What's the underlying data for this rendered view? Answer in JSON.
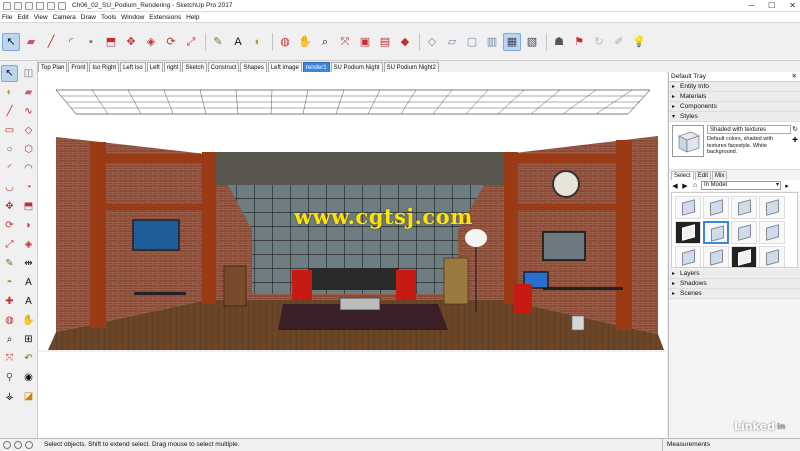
{
  "window": {
    "title": "Ch06_02_SU_Podium_Rendering - SketchUp Pro 2017",
    "controls": [
      "─",
      "☐",
      "✕"
    ]
  },
  "menu": [
    "File",
    "Edit",
    "View",
    "Camera",
    "Draw",
    "Tools",
    "Window",
    "Extensions",
    "Help"
  ],
  "scene_tabs": [
    {
      "label": "Top Plan",
      "active": false
    },
    {
      "label": "Front",
      "active": false
    },
    {
      "label": "Iso Right",
      "active": false
    },
    {
      "label": "Left Iso",
      "active": false
    },
    {
      "label": "Left",
      "active": false
    },
    {
      "label": "right",
      "active": false
    },
    {
      "label": "Sketch",
      "active": false
    },
    {
      "label": "Construct",
      "active": false
    },
    {
      "label": "Shapes",
      "active": false
    },
    {
      "label": "Left image",
      "active": false
    },
    {
      "label": "render1",
      "active": true
    },
    {
      "label": "SU Podium Night",
      "active": false
    },
    {
      "label": "SU Podium Night2",
      "active": false
    }
  ],
  "watermark": "www.cgtsj.com",
  "tray": {
    "title": "Default Tray",
    "panels_top": [
      "Entity Info",
      "Materials",
      "Components",
      "Styles"
    ],
    "style": {
      "name": "Shaded with textures",
      "description": "Default colors, shaded with textures facestyle. White background."
    },
    "style_tabs": [
      {
        "label": "Select",
        "active": true
      },
      {
        "label": "Edit",
        "active": false
      },
      {
        "label": "Mix",
        "active": false
      }
    ],
    "collection": "In Model",
    "panels_bottom": [
      "Layers",
      "Shadows",
      "Scenes"
    ]
  },
  "status": {
    "message": "Select objects. Shift to extend select. Drag mouse to select multiple.",
    "measurements_label": "Measurements"
  },
  "brand": {
    "text": "Linked",
    "badge": "in"
  },
  "colors": {
    "accent": "#3a86d8",
    "watermark": "#ffe400"
  }
}
